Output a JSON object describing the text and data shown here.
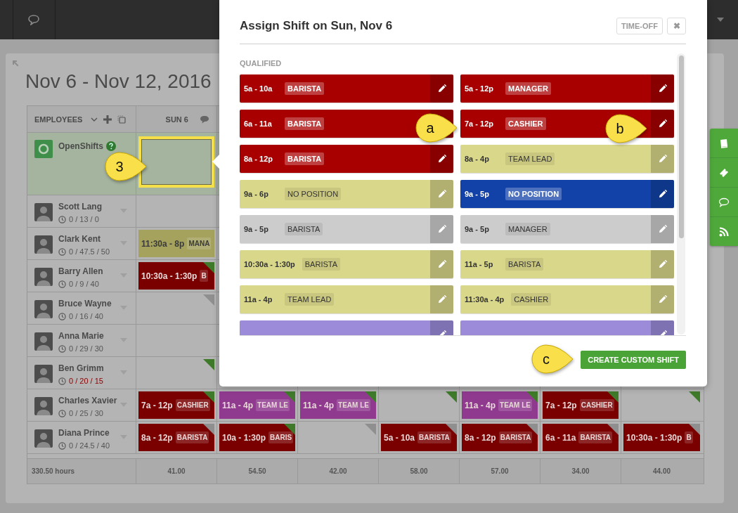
{
  "schedule": {
    "title": "Nov 6 - Nov 12, 2016",
    "employees_header": "EMPLOYEES",
    "days": [
      {
        "label": "SUN 6"
      }
    ],
    "open_shifts": {
      "name": "OpenShifts",
      "cells": [
        {
          "selected": true
        }
      ]
    },
    "employees": [
      {
        "name": "Scott Lang",
        "hours": "0 / 13 / 0",
        "over": false,
        "cells": [
          {
            "kind": "blank"
          }
        ]
      },
      {
        "name": "Clark Kent",
        "hours": "0 / 47.5 / 50",
        "over": false,
        "cells": [
          {
            "kind": "shift",
            "time": "11:30a - 8p",
            "role": "MANA",
            "color": "#a5a25e"
          }
        ]
      },
      {
        "name": "Barry Allen",
        "hours": "0 / 9 / 40",
        "over": false,
        "cells": [
          {
            "kind": "shift",
            "time": "10:30a - 1:30p",
            "role": "B",
            "color": "#7a0000",
            "flag": {
              "color": "#3f7a2a"
            }
          }
        ]
      },
      {
        "name": "Bruce Wayne",
        "hours": "0 / 16 / 40",
        "over": false,
        "cells": [
          {
            "kind": "blank",
            "flag": {
              "color": "#8f8f8f"
            }
          }
        ]
      },
      {
        "name": "Anna Marie",
        "hours": "0 / 29 / 30",
        "over": false,
        "cells": [
          {
            "kind": "blank"
          }
        ]
      },
      {
        "name": "Ben Grimm",
        "hours": "0 / 20 / 15",
        "over": true,
        "cells": [
          {
            "kind": "blank",
            "flag": {
              "color": "#3f7a2a"
            }
          }
        ]
      },
      {
        "name": "Charles Xavier",
        "hours": "0 / 25 / 30",
        "over": false,
        "cells": [
          {
            "kind": "shift",
            "time": "7a - 12p",
            "role": "CASHIER",
            "color": "#7a0000",
            "flag": {
              "color": "#3f7a2a"
            }
          },
          {
            "kind": "shift",
            "time": "11a - 4p",
            "role": "TEAM LE",
            "color": "#8f3a8f",
            "flag": {
              "color": "#3f7a2a"
            }
          },
          {
            "kind": "shift",
            "time": "11a - 4p",
            "role": "TEAM LE",
            "color": "#8f3a8f",
            "flag": {
              "color": "#3f7a2a"
            }
          },
          {
            "kind": "blank",
            "flag": {
              "color": "#3f7a2a"
            }
          },
          {
            "kind": "shift",
            "time": "11a - 4p",
            "role": "TEAM LE",
            "color": "#8f3a8f",
            "flag": {
              "color": "#3f7a2a"
            }
          },
          {
            "kind": "shift",
            "time": "7a - 12p",
            "role": "CASHIER",
            "color": "#7a0000",
            "flag": {
              "color": "#3f7a2a"
            }
          },
          {
            "kind": "blank",
            "flag": {
              "color": "#3f7a2a"
            }
          }
        ]
      },
      {
        "name": "Diana Prince",
        "hours": "0 / 24.5 / 40",
        "over": false,
        "cells": [
          {
            "kind": "shift",
            "time": "8a - 12p",
            "role": "BARISTA",
            "color": "#7a0000",
            "flag": {
              "color": "#8f8f8f"
            }
          },
          {
            "kind": "shift",
            "time": "10a - 1:30p",
            "role": "BARIS",
            "color": "#7a0000",
            "flag": {
              "color": "#3f7a2a"
            }
          },
          {
            "kind": "blank",
            "flag": {
              "color": "#8f8f8f"
            }
          },
          {
            "kind": "shift",
            "time": "5a - 10a",
            "role": "BARISTA",
            "color": "#7a0000",
            "flag": {
              "color": "#8f8f8f"
            }
          },
          {
            "kind": "shift",
            "time": "8a - 12p",
            "role": "BARISTA",
            "color": "#7a0000",
            "flag": {
              "color": "#8f8f8f"
            }
          },
          {
            "kind": "shift",
            "time": "6a - 11a",
            "role": "BARISTA",
            "color": "#7a0000",
            "flag": {
              "color": "#8f8f8f"
            }
          },
          {
            "kind": "shift",
            "time": "10:30a - 1:30p",
            "role": "B",
            "color": "#7a0000",
            "flag": {
              "color": "#8f8f8f"
            }
          }
        ]
      }
    ],
    "total": "330.50 hours",
    "totals": [
      "41.00",
      "54.50",
      "42.00",
      "58.00",
      "57.00",
      "34.00",
      "44.00"
    ]
  },
  "modal": {
    "title": "Assign Shift on Sun, Nov 6",
    "time_off": "TIME-OFF",
    "close": "✖",
    "section": "QUALIFIED",
    "options": [
      {
        "time": "5a - 10a",
        "role": "BARISTA",
        "color": "#a80000"
      },
      {
        "time": "5a - 12p",
        "role": "MANAGER",
        "color": "#a80000"
      },
      {
        "time": "6a - 11a",
        "role": "BARISTA",
        "color": "#a80000"
      },
      {
        "time": "7a - 12p",
        "role": "CASHIER",
        "color": "#a80000"
      },
      {
        "time": "8a - 12p",
        "role": "BARISTA",
        "color": "#a80000"
      },
      {
        "time": "8a - 4p",
        "role": "TEAM LEAD",
        "color": "#d9d78a"
      },
      {
        "time": "9a - 6p",
        "role": "NO POSITION",
        "color": "#d9d78a"
      },
      {
        "time": "9a - 5p",
        "role": "NO POSITION",
        "color": "#1242a8"
      },
      {
        "time": "9a - 5p",
        "role": "BARISTA",
        "color": "#cccccc"
      },
      {
        "time": "9a - 5p",
        "role": "MANAGER",
        "color": "#cccccc"
      },
      {
        "time": "10:30a - 1:30p",
        "role": "BARISTA",
        "color": "#d9d78a"
      },
      {
        "time": "11a - 5p",
        "role": "BARISTA",
        "color": "#d9d78a"
      },
      {
        "time": "11a - 4p",
        "role": "TEAM LEAD",
        "color": "#d9d78a"
      },
      {
        "time": "11:30a - 4p",
        "role": "CASHIER",
        "color": "#d9d78a"
      },
      {
        "color": "#9b8bd9"
      },
      {
        "color": "#9b8bd9"
      }
    ],
    "create": "CREATE CUSTOM SHIFT"
  },
  "callouts": [
    {
      "label": "3"
    },
    {
      "label": "a"
    },
    {
      "label": "b"
    },
    {
      "label": "c"
    }
  ]
}
